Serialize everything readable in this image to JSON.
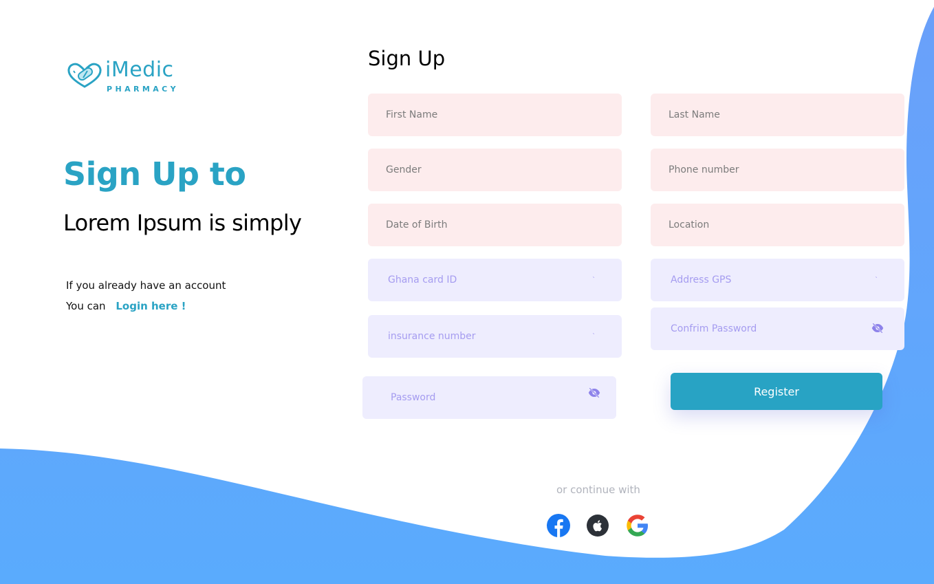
{
  "colors": {
    "brand": "#2aa3c4",
    "pink_field": "#fdeced",
    "lavender_field": "#eeedfe",
    "lavender_text": "#a59cf0",
    "wave_blue": "#5dabfd",
    "register_button": "#28a3c4"
  },
  "logo": {
    "name": "iMedic",
    "tagline": "PHARMACY",
    "icon": "pill-heart-logo-icon"
  },
  "hero": {
    "title": "Sign Up to",
    "subtitle": "Lorem Ipsum is simply",
    "account_note": "If you already have an account",
    "login_prefix": "You can",
    "login_link": "Login here !"
  },
  "form": {
    "title": "Sign Up",
    "first_name": "First Name",
    "last_name": "Last Name",
    "gender": "Gender",
    "phone": "Phone number",
    "dob": "Date of Birth",
    "location": "Location",
    "ghana_card": "Ghana card ID",
    "address_gps": "Address GPS",
    "insurance": "insurance number",
    "confirm_password": "Confrim Password",
    "password": "Password",
    "tick": "`",
    "register": "Register",
    "eye_icon": "eye-slash-icon"
  },
  "social": {
    "label": "or continue with",
    "providers": [
      "facebook",
      "apple",
      "google"
    ]
  }
}
